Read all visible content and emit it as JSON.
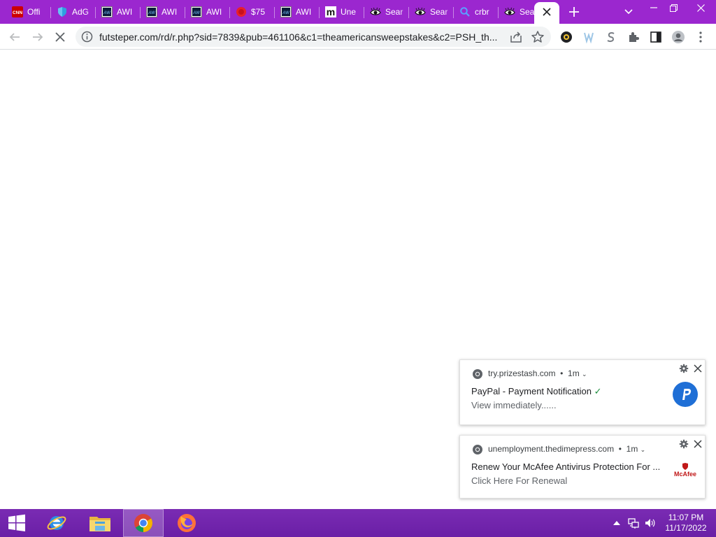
{
  "browser": {
    "tabs": [
      {
        "title": "Offi",
        "favicon": "cnn-icon",
        "active": false
      },
      {
        "title": "AdG",
        "favicon": "shield-icon",
        "active": false
      },
      {
        "title": "AWI",
        "favicon": "aw-icon",
        "active": false
      },
      {
        "title": "AWI",
        "favicon": "aw-icon",
        "active": false
      },
      {
        "title": "AWI",
        "favicon": "aw-icon",
        "active": false
      },
      {
        "title": "$75",
        "favicon": "red-circle-icon",
        "active": false
      },
      {
        "title": "AWI",
        "favicon": "aw-icon",
        "active": false
      },
      {
        "title": "Une",
        "favicon": "m-icon",
        "active": false
      },
      {
        "title": "Sear",
        "favicon": "eye-icon",
        "active": false
      },
      {
        "title": "Sear",
        "favicon": "eye-icon",
        "active": false
      },
      {
        "title": "crbr",
        "favicon": "search-icon",
        "active": false
      },
      {
        "title": "Sear",
        "favicon": "eye-icon",
        "active": false
      },
      {
        "title": "",
        "favicon": "",
        "active": true
      }
    ],
    "address_bar": {
      "url": "futsteper.com/rd/r.php?sid=7839&pub=461106&c1=theamericansweepstakes&c2=PSH_th..."
    },
    "accent_color": "#9b27cf"
  },
  "notifications": [
    {
      "site": "try.prizestash.com",
      "age": "1m",
      "title": "PayPal - Payment Notification",
      "check": "✓",
      "body": "View immediately......",
      "image": "paypal-icon"
    },
    {
      "site": "unemployment.thedimepress.com",
      "age": "1m",
      "title": "Renew Your McAfee Antivirus Protection For ...",
      "body": "Click Here For Renewal",
      "image": "mcafee-logo",
      "logo_text": "McAfee"
    }
  ],
  "taskbar": {
    "apps": [
      "start-icon",
      "internet-explorer-icon",
      "file-explorer-icon",
      "chrome-icon",
      "firefox-icon"
    ],
    "clock": {
      "time": "11:07 PM",
      "date": "11/17/2022"
    },
    "color": "#6a1fa6"
  }
}
